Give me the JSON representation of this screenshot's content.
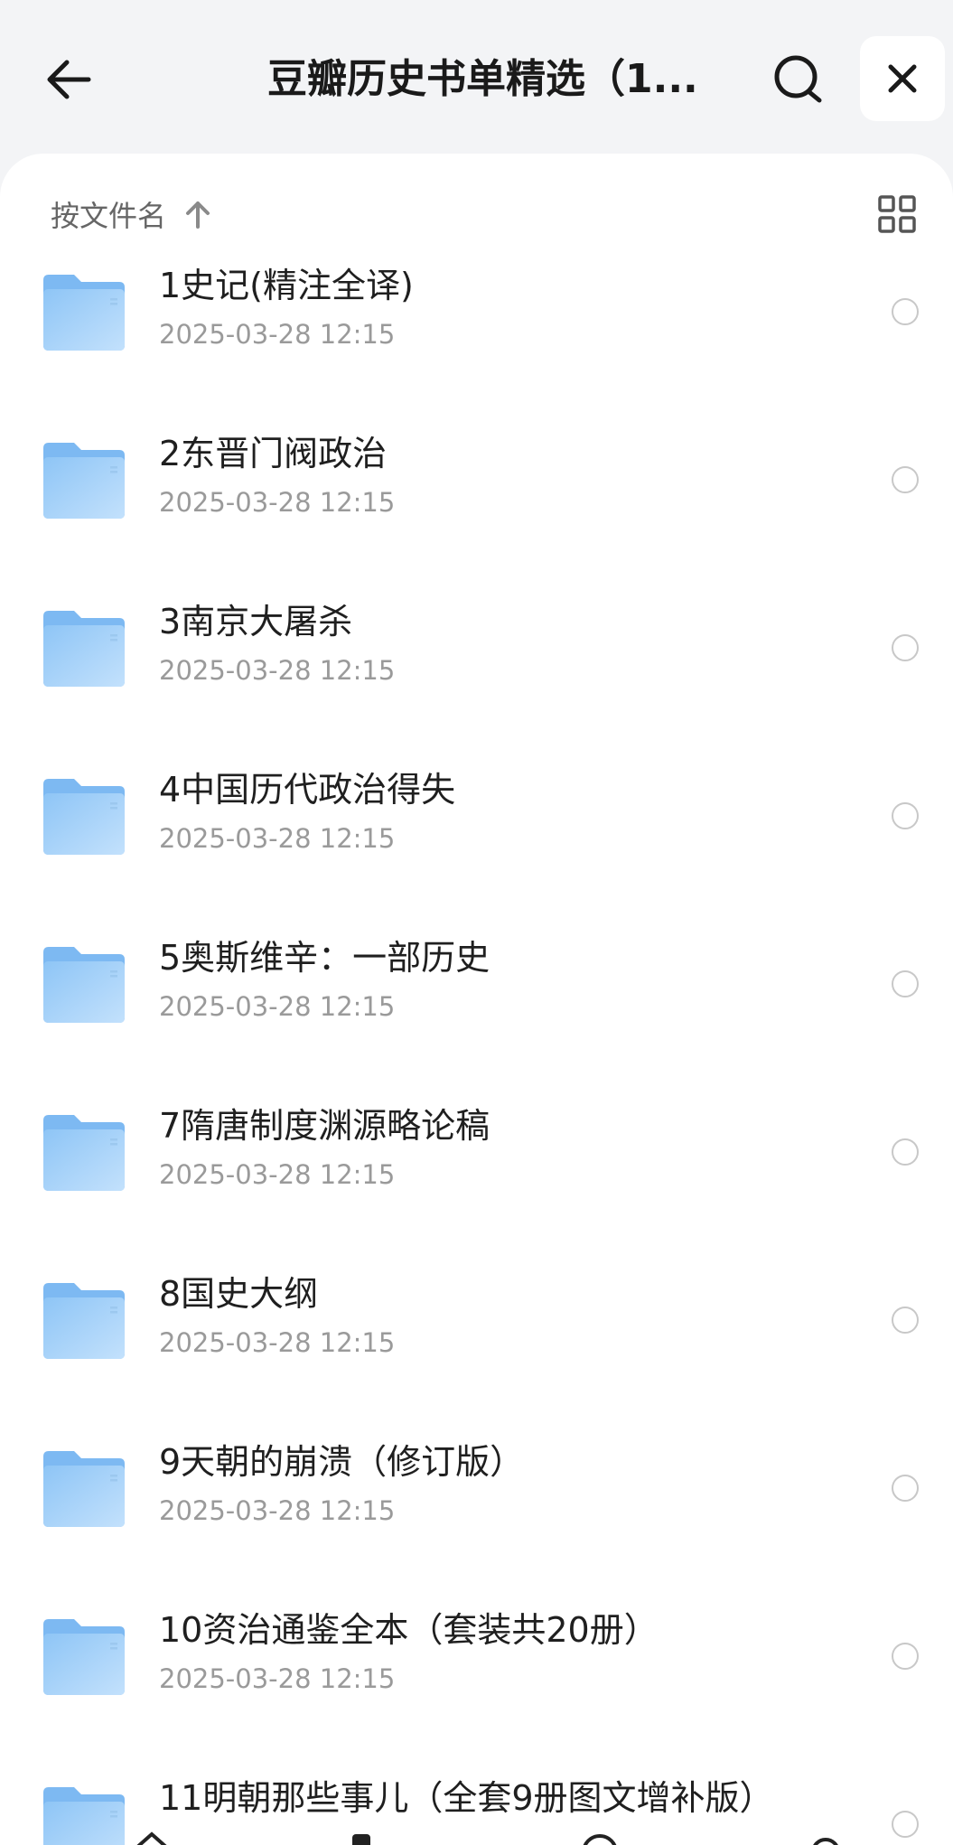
{
  "header": {
    "title": "豆瓣历史书单精选（1...",
    "back_icon": "arrow-left-icon",
    "search_icon": "search-icon",
    "close_icon": "close-icon"
  },
  "sort": {
    "label": "按文件名",
    "direction_icon": "arrow-up-icon",
    "view_toggle_icon": "grid-view-icon"
  },
  "colors": {
    "folder": "#7db9f2",
    "folder_light": "#b7dbfb",
    "background": "#f3f4f6"
  },
  "files": [
    {
      "name": "1史记(精注全译)",
      "date": "2025-03-28 12:15"
    },
    {
      "name": "2东晋门阀政治",
      "date": "2025-03-28 12:15"
    },
    {
      "name": "3南京大屠杀",
      "date": "2025-03-28 12:15"
    },
    {
      "name": "4中国历代政治得失",
      "date": "2025-03-28 12:15"
    },
    {
      "name": "5奥斯维辛：一部历史",
      "date": "2025-03-28 12:15"
    },
    {
      "name": "7隋唐制度渊源略论稿",
      "date": "2025-03-28 12:15"
    },
    {
      "name": "8国史大纲",
      "date": "2025-03-28 12:15"
    },
    {
      "name": "9天朝的崩溃（修订版）",
      "date": "2025-03-28 12:15"
    },
    {
      "name": "10资治通鉴全本（套装共20册）",
      "date": "2025-03-28 12:15"
    },
    {
      "name": "11明朝那些事儿（全套9册图文增补版）",
      "date": ""
    }
  ]
}
